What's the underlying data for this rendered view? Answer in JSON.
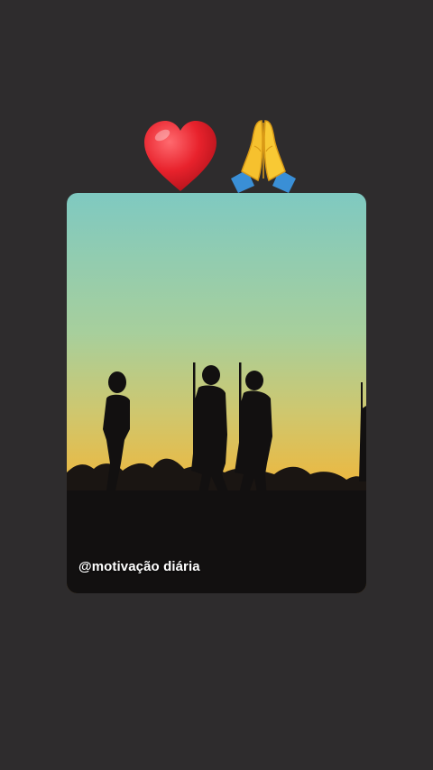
{
  "story": {
    "stickers": [
      {
        "name": "red-heart-icon",
        "color": "#e8222c"
      },
      {
        "name": "folded-hands-icon",
        "color": "#f6c12e"
      }
    ],
    "media": {
      "sky_top_color": "#7fc9c1",
      "sky_horizon_color": "#f3b12a",
      "silhouette_color": "#121010"
    },
    "caption": "@motivação diária"
  }
}
